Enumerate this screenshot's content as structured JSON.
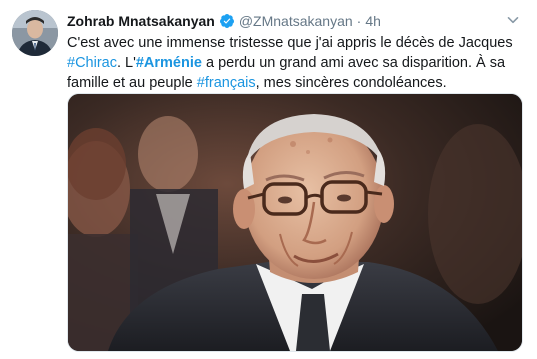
{
  "tweet": {
    "author_name": "Zohrab Mnatsakanyan",
    "handle": "@ZMnatsakanyan",
    "separator": "·",
    "time": "4h",
    "text": {
      "part1": "C'est avec une immense tristesse que j'ai appris le décès de Jacques ",
      "tag1": "#Chirac",
      "part2": ". L'",
      "tag2": "#Arménie",
      "part3": " a perdu un grand ami avec sa disparition. À sa famille et au peuple ",
      "tag3": "#français",
      "part4": ", mes sincères condoléances."
    },
    "icons": {
      "verified": "verified-badge-icon",
      "menu": "chevron-down-icon"
    },
    "colors": {
      "link": "#1b95e0",
      "verified": "#1da1f2",
      "secondary_text": "#657786"
    }
  }
}
